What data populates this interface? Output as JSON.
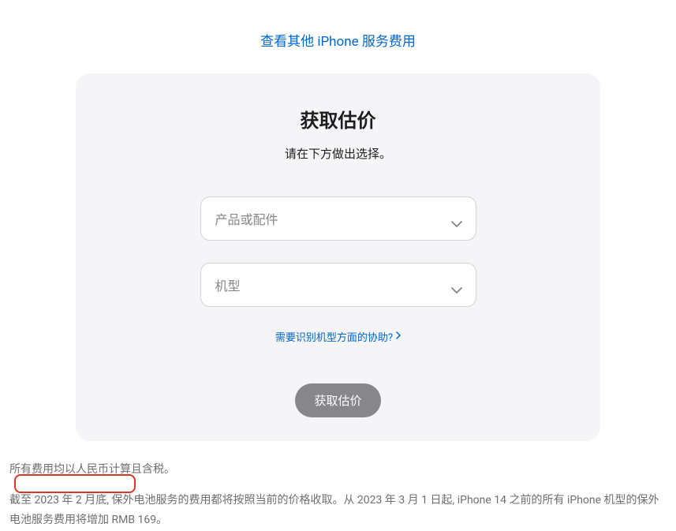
{
  "header": {
    "top_link": "查看其他 iPhone 服务费用"
  },
  "card": {
    "title": "获取估价",
    "subtitle": "请在下方做出选择。",
    "select_product_placeholder": "产品或配件",
    "select_model_placeholder": "机型",
    "help_link": "需要识别机型方面的协助?",
    "submit_button": "获取估价"
  },
  "footer": {
    "line1": "所有费用均以人民币计算且含税。",
    "line2": "截至 2023 年 2 月底, 保外电池服务的费用都将按照当前的价格收取。从 2023 年 3 月 1 日起, iPhone 14 之前的所有 iPhone 机型的保外电池服务费用将增加 RMB 169。"
  }
}
